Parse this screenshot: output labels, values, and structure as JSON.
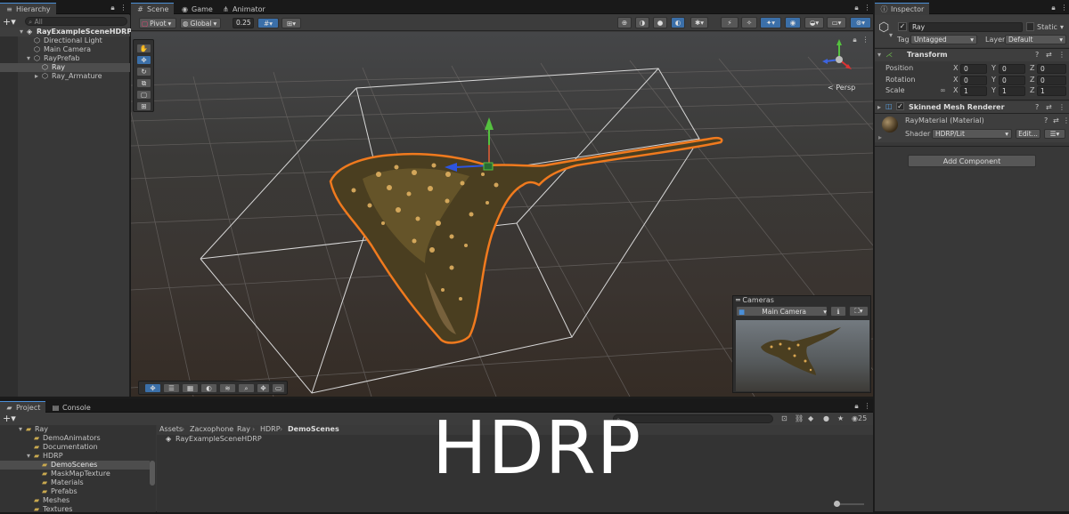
{
  "hierarchy": {
    "tab": "Hierarchy",
    "search_placeholder": "All",
    "items": [
      {
        "label": "RayExampleSceneHDRP"
      },
      {
        "label": "Directional Light"
      },
      {
        "label": "Main Camera"
      },
      {
        "label": "RayPrefab"
      },
      {
        "label": "Ray"
      },
      {
        "label": "Ray_Armature"
      }
    ]
  },
  "scene": {
    "tabs": [
      "Scene",
      "Game",
      "Animator"
    ],
    "pivot": "Pivot",
    "global": "Global",
    "grid_snap": "0.25",
    "persp": "Persp",
    "cameras_overlay": {
      "title": "Cameras",
      "selected": "Main Camera"
    }
  },
  "inspector": {
    "tab": "Inspector",
    "object_name": "Ray",
    "static_label": "Static",
    "tag_label": "Tag",
    "tag_value": "Untagged",
    "layer_label": "Layer",
    "layer_value": "Default",
    "transform": {
      "title": "Transform",
      "position_label": "Position",
      "rotation_label": "Rotation",
      "scale_label": "Scale",
      "position": [
        "0",
        "0",
        "0"
      ],
      "rotation": [
        "0",
        "0",
        "0"
      ],
      "scale": [
        "1",
        "1",
        "1"
      ],
      "axes": [
        "X",
        "Y",
        "Z"
      ]
    },
    "skinned_mesh": {
      "title": "Skinned Mesh Renderer",
      "material_name": "RayMaterial (Material)",
      "shader_label": "Shader",
      "shader_value": "HDRP/Lit",
      "edit_label": "Edit..."
    },
    "add_component": "Add Component"
  },
  "project": {
    "tabs": [
      "Project",
      "Console"
    ],
    "tree": [
      {
        "label": "Ray"
      },
      {
        "label": "DemoAnimators"
      },
      {
        "label": "Documentation"
      },
      {
        "label": "HDRP"
      },
      {
        "label": "DemoScenes"
      },
      {
        "label": "MaskMapTexture"
      },
      {
        "label": "Materials"
      },
      {
        "label": "Prefabs"
      },
      {
        "label": "Meshes"
      },
      {
        "label": "Textures"
      }
    ],
    "breadcrumb": [
      "Assets",
      "Zacxophone",
      "Ray",
      "HDRP",
      "DemoScenes"
    ],
    "files": [
      {
        "label": "RayExampleSceneHDRP"
      }
    ],
    "count": "25"
  },
  "overlay_caption": "HDRP",
  "colors": {
    "accent": "#4a8fd8",
    "selection_outline": "#f07a1e",
    "panel": "#383838"
  }
}
